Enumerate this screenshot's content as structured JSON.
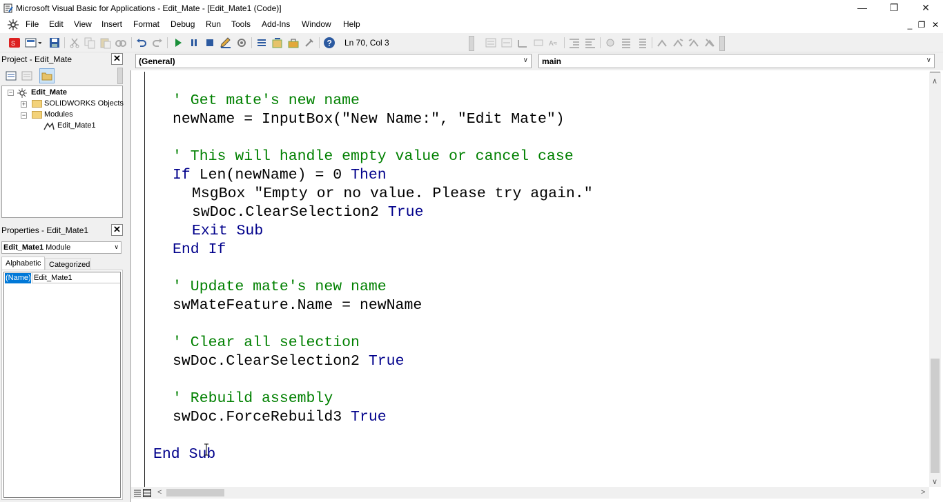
{
  "window": {
    "title": "Microsoft Visual Basic for Applications - Edit_Mate - [Edit_Mate1 (Code)]",
    "controls": {
      "minimize": "—",
      "restore": "❐",
      "close": "✕"
    }
  },
  "menu": {
    "items": [
      "File",
      "Edit",
      "View",
      "Insert",
      "Format",
      "Debug",
      "Run",
      "Tools",
      "Add-Ins",
      "Window",
      "Help"
    ],
    "mdi": {
      "minimize": "_",
      "restore": "❐",
      "close": "✕"
    }
  },
  "toolbar": {
    "position": "Ln 70, Col 3"
  },
  "project": {
    "title": "Project - Edit_Mate",
    "tree": {
      "root": "Edit_Mate",
      "objects": "SOLIDWORKS Objects",
      "modules": "Modules",
      "module": "Edit_Mate1"
    }
  },
  "properties": {
    "title": "Properties - Edit_Mate1",
    "object_name": "Edit_Mate1",
    "object_type": "Module",
    "tabs": [
      "Alphabetic",
      "Categorized"
    ],
    "rows": [
      {
        "name": "(Name)",
        "value": "Edit_Mate1"
      }
    ]
  },
  "code_editor": {
    "object_combo": "(General)",
    "procedure_combo": "main",
    "lines": [
      {
        "c": "' Get mate's new name"
      },
      {
        "p": "newName = InputBox(\"New Name:\", \"Edit Mate\")"
      },
      {
        "c": "' This will handle empty value or cancel case"
      },
      {
        "k1": "If",
        "p": " Len(newName) = 0 ",
        "k2": "Then"
      },
      {
        "p": "MsgBox \"Empty or no value. Please try again.\""
      },
      {
        "p": "swDoc.ClearSelection2 ",
        "k": "True"
      },
      {
        "k": "Exit Sub"
      },
      {
        "k": "End If"
      },
      {
        "c": "' Update mate's new name"
      },
      {
        "p": "swMateFeature.Name = newName"
      },
      {
        "c": "' Clear all selection"
      },
      {
        "p": "swDoc.ClearSelection2 ",
        "k": "True"
      },
      {
        "c": "' Rebuild assembly"
      },
      {
        "p": "swDoc.ForceRebuild3 ",
        "k": "True"
      },
      {
        "k": "End Sub"
      }
    ]
  },
  "colors": {
    "comment": "#008000",
    "keyword": "#00008b",
    "selection": "#0078d7"
  }
}
